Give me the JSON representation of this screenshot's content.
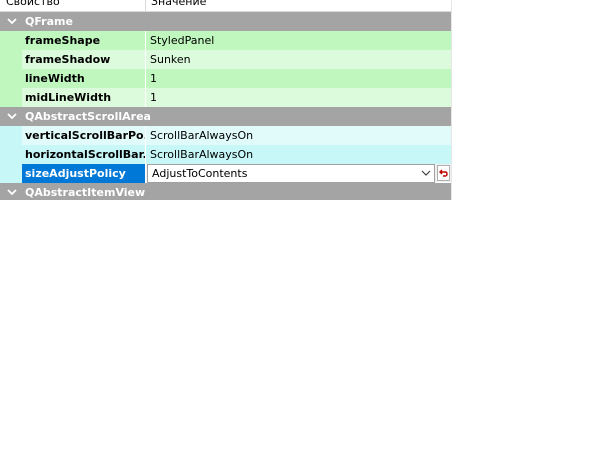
{
  "header": {
    "col_property": "Свойство",
    "col_value": "Значение"
  },
  "groups": {
    "qframe": {
      "label": "QFrame"
    },
    "qabstractscrollarea": {
      "label": "QAbstractScrollArea"
    },
    "qabstractitemview": {
      "label": "QAbstractItemView"
    }
  },
  "properties": {
    "frameShape": {
      "name": "frameShape",
      "value": "StyledPanel"
    },
    "frameShadow": {
      "name": "frameShadow",
      "value": "Sunken"
    },
    "lineWidth": {
      "name": "lineWidth",
      "value": "1"
    },
    "midLineWidth": {
      "name": "midLineWidth",
      "value": "1"
    },
    "verticalScrollBarPolicy": {
      "name": "verticalScrollBarPo...",
      "value": "ScrollBarAlwaysOn"
    },
    "horizontalScrollBarPolicy": {
      "name": "horizontalScrollBar...",
      "value": "ScrollBarAlwaysOn"
    },
    "sizeAdjustPolicy": {
      "name": "sizeAdjustPolicy",
      "value": "AdjustToContents"
    }
  },
  "colors": {
    "group_header": "#a4a4a4",
    "frame_group": "#bff7bf",
    "scroll_group": "#c7f7f7",
    "selection": "#0078d7",
    "reset_icon": "#c00000"
  },
  "icons": {
    "expand": "chevron-down-icon",
    "combo_arrow": "chevron-down-icon",
    "reset": "reset-arrow-icon"
  }
}
